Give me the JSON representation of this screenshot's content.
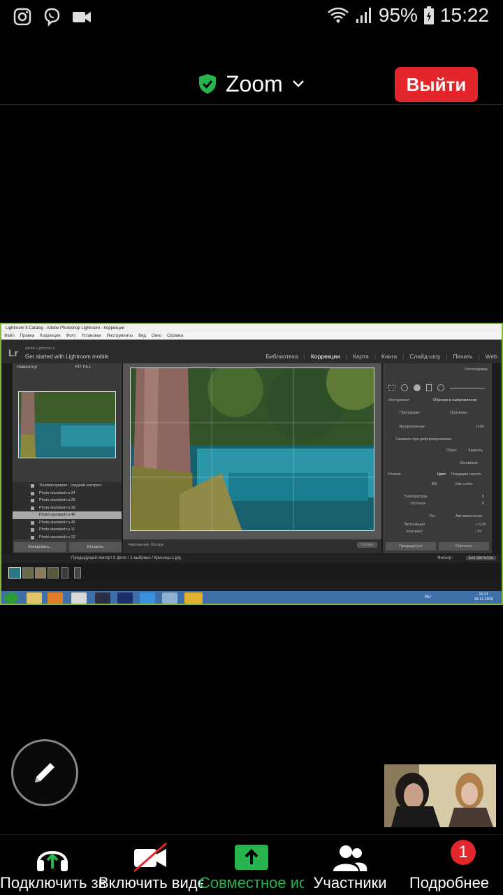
{
  "status_bar": {
    "battery": "95%",
    "time": "15:22",
    "left_icons": [
      "instagram-icon",
      "viber-icon",
      "video-icon"
    ],
    "right_icons": [
      "wifi-icon",
      "signal-icon",
      "battery-icon"
    ]
  },
  "header": {
    "title": "Zoom",
    "exit_label": "Выйти",
    "shield_color": "#27b34e",
    "exit_color": "#e2262b"
  },
  "shared_screen": {
    "window_title": "Lightroom 5 Catalog - Adobe Photoshop Lightroom - Коррекции",
    "menu": [
      "Файл",
      "Правка",
      "Коррекции",
      "Фото",
      "Установки",
      "Инструменты",
      "Вид",
      "Окно",
      "Справка"
    ],
    "brand": "Adobe Lightroom 5",
    "mobile_link": "Get started with Lightroom mobile",
    "modules": [
      "Библиотека",
      "Коррекции",
      "Карта",
      "Книга",
      "Слайд-шоу",
      "Печать",
      "Web"
    ],
    "active_module": "Коррекции",
    "navigator_label": "Навигатор",
    "navigator_zoom": "FIT   FILL",
    "presets": [
      "Тоновая кривая - средний контраст",
      "Photo-standard.ru 24",
      "Photo-standard.ru 26",
      "Photo-standard.ru 38",
      "Photo-standard.ru 40",
      "Photo-standard.ru 46",
      "Photo-standard.ru 11",
      "Photo-standard.ru 12"
    ],
    "selected_preset_index": 4,
    "left_buttons": [
      "Копировать...",
      "Вставить"
    ],
    "crop_toolbar": "Наложение: Всегда",
    "done_label": "Готово",
    "right_panel": {
      "histogram": "Гистограмма",
      "tool": "Инструмент",
      "crop_label": "Обрезка и выпрямление",
      "aspect": "Пропорции:",
      "aspect_value": "Оригинал",
      "straighten": "Выпрямление",
      "straighten_value": "0,00",
      "constrain": "Сжимать при деформировании",
      "reset": "Сброс",
      "close": "Закрыть",
      "basic": "Основные",
      "treatment": "Режим:",
      "color": "Цвет",
      "bw": "Градации серого",
      "wb": "ББ:",
      "wb_value": "Как снято",
      "temperature": "Температура",
      "temperature_value": "0",
      "tint": "Оттенок",
      "tint_value": "0",
      "tone": "Тон",
      "auto": "Автоматически",
      "exposure": "Экспозиция",
      "exposure_value": "+ 0,39",
      "contrast": "Контраст",
      "contrast_value": "- 53",
      "prev_button": "Предыдущее",
      "reset_button": "Сбросить"
    },
    "filmstrip_path": "Предыдущий импорт  6 фото / 1 выбрано / Криница 1.jpg",
    "filter_label": "Фильтр:",
    "filter_value": "Без фильтра",
    "taskbar_lang": "RU",
    "taskbar_time": "15:21",
    "taskbar_date": "18.12.2020"
  },
  "annotate": {
    "icon": "pencil-icon"
  },
  "toolbar": {
    "items": [
      {
        "label": "Подключить звук",
        "icon": "headphones-icon"
      },
      {
        "label": "Включить видео",
        "icon": "video-off-icon"
      },
      {
        "label": "Совместное использование",
        "icon": "share-icon"
      },
      {
        "label": "Участники",
        "icon": "participants-icon"
      },
      {
        "label": "Подробнее",
        "icon": "more-icon"
      }
    ],
    "badge": "1",
    "share_color": "#27b34e"
  }
}
